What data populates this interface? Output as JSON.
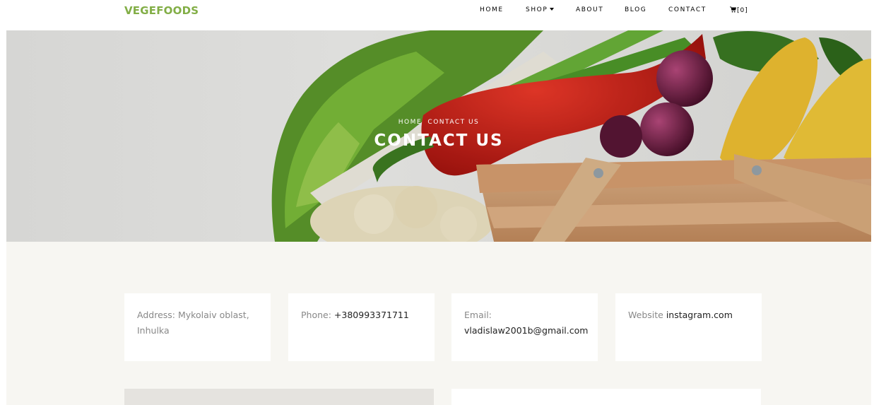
{
  "brand": {
    "name": "VEGEFOODS",
    "color": "#82ae46"
  },
  "nav": {
    "home": "HOME",
    "shop": "SHOP",
    "about": "ABOUT",
    "blog": "BLOG",
    "contact": "CONTACT",
    "cart": "[0]"
  },
  "hero": {
    "breadcrumb_home": "HOME",
    "breadcrumb_current": "CONTACT US",
    "title": "CONTACT US"
  },
  "contact_info": {
    "address_label": "Address:",
    "address_value": "Mykolaiv oblast, Inhulka",
    "phone_label": "Phone:",
    "phone_value": "+380993371711",
    "email_label": "Email:",
    "email_value": "vladislaw2001b@gmail.com",
    "website_label": "Website",
    "website_value": "instagram.com"
  },
  "icons": [
    "cart-icon",
    "chevron-down-icon"
  ]
}
